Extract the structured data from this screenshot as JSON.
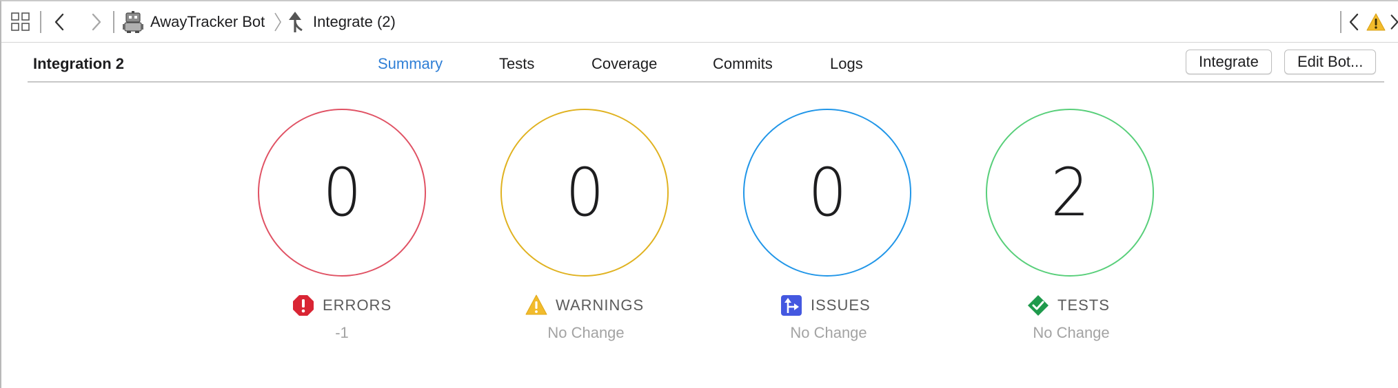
{
  "jumpbar": {
    "bot_name": "AwayTracker Bot",
    "integration_name": "Integrate (2)"
  },
  "header": {
    "title": "Integration 2",
    "tabs": [
      {
        "label": "Summary",
        "active": true
      },
      {
        "label": "Tests",
        "active": false
      },
      {
        "label": "Coverage",
        "active": false
      },
      {
        "label": "Commits",
        "active": false
      },
      {
        "label": "Logs",
        "active": false
      }
    ],
    "integrate_button": "Integrate",
    "edit_bot_button": "Edit Bot..."
  },
  "stats": [
    {
      "key": "errors",
      "value": "0",
      "label": "ERRORS",
      "delta": "-1",
      "color": "#e05264",
      "icon": "error-icon"
    },
    {
      "key": "warnings",
      "value": "0",
      "label": "WARNINGS",
      "delta": "No Change",
      "color": "#e0b220",
      "icon": "warning-icon"
    },
    {
      "key": "issues",
      "value": "0",
      "label": "ISSUES",
      "delta": "No Change",
      "color": "#2196e8",
      "icon": "issues-icon"
    },
    {
      "key": "tests",
      "value": "2",
      "label": "TESTS",
      "delta": "No Change",
      "color": "#58cf7a",
      "icon": "tests-icon"
    }
  ],
  "colors": {
    "accent": "#2f7fd6",
    "error_icon": "#d92534",
    "warning_icon": "#f2bb2c",
    "issues_icon": "#4458e0",
    "tests_icon": "#1f9a4c"
  }
}
